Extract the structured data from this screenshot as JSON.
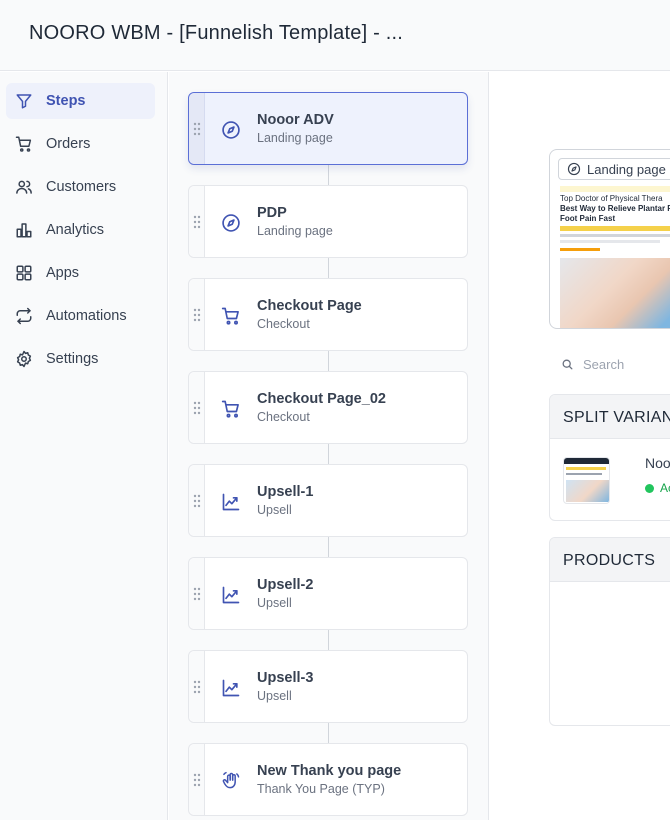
{
  "header": {
    "title": "NOORO WBM - [Funnelish Template] - ..."
  },
  "sidebar": {
    "items": [
      {
        "label": "Steps",
        "icon": "filter-icon",
        "active": true
      },
      {
        "label": "Orders",
        "icon": "cart-icon"
      },
      {
        "label": "Customers",
        "icon": "users-icon"
      },
      {
        "label": "Analytics",
        "icon": "bar-chart-icon"
      },
      {
        "label": "Apps",
        "icon": "grid-icon"
      },
      {
        "label": "Automations",
        "icon": "repeat-icon"
      },
      {
        "label": "Settings",
        "icon": "gear-icon"
      }
    ]
  },
  "steps": [
    {
      "name": "Nooor ADV",
      "type": "Landing page",
      "icon": "compass-icon",
      "active": true
    },
    {
      "name": "PDP",
      "type": "Landing page",
      "icon": "compass-icon"
    },
    {
      "name": "Checkout Page",
      "type": "Checkout",
      "icon": "cart-icon"
    },
    {
      "name": "Checkout Page_02",
      "type": "Checkout",
      "icon": "cart-icon"
    },
    {
      "name": "Upsell-1",
      "type": "Upsell",
      "icon": "trend-icon"
    },
    {
      "name": "Upsell-2",
      "type": "Upsell",
      "icon": "trend-icon"
    },
    {
      "name": "Upsell-3",
      "type": "Upsell",
      "icon": "trend-icon"
    },
    {
      "name": "New Thank you page",
      "type": "Thank You Page (TYP)",
      "icon": "wave-hand-icon"
    }
  ],
  "detail": {
    "preview_badge": "Landing page",
    "preview_headline_1": "Top Doctor of Physical Thera",
    "preview_headline_2": "Best Way to Relieve Plantar F",
    "preview_headline_3": "Foot Pain Fast",
    "search_placeholder": "Search",
    "split_variants_title": "SPLIT VARIAN",
    "variant_name": "Noo",
    "variant_status": "Ac",
    "products_title": "PRODUCTS"
  },
  "colors": {
    "accent": "#4054b2",
    "active_bg": "#eef1fb",
    "status_green": "#22c55e"
  }
}
